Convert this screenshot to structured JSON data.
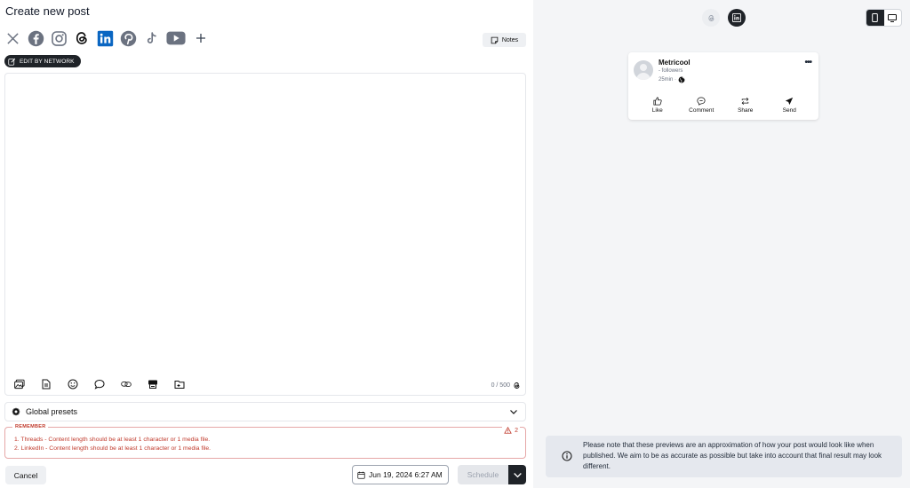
{
  "page": {
    "title": "Create new post"
  },
  "networks": [
    {
      "name": "X",
      "icon": "x-icon"
    },
    {
      "name": "Facebook",
      "icon": "facebook-icon"
    },
    {
      "name": "Instagram",
      "icon": "instagram-icon"
    },
    {
      "name": "Threads",
      "icon": "threads-icon"
    },
    {
      "name": "LinkedIn",
      "icon": "linkedin-icon"
    },
    {
      "name": "Pinterest",
      "icon": "pinterest-icon"
    },
    {
      "name": "TikTok",
      "icon": "tiktok-icon"
    },
    {
      "name": "YouTube",
      "icon": "youtube-icon"
    },
    {
      "name": "Add",
      "icon": "plus-icon"
    }
  ],
  "notes": {
    "label": "Notes"
  },
  "edit_by_network": {
    "label": "EDIT BY NETWORK"
  },
  "editor": {
    "value": "",
    "counter": "0 / 500"
  },
  "presets": {
    "label": "Global presets"
  },
  "remember": {
    "title": "REMEMBER",
    "count": "2",
    "items": [
      "1. Threads - Content length should be at least 1 character or 1 media file.",
      "2. LinkedIn - Content length should be at least 1 character or 1 media file."
    ]
  },
  "footer": {
    "cancel": "Cancel",
    "date": "Jun 19, 2024 6:27 AM",
    "schedule": "Schedule"
  },
  "preview": {
    "account_name": "Metricool",
    "followers": "- followers",
    "time": "25min ·",
    "actions": [
      "Like",
      "Comment",
      "Share",
      "Send"
    ],
    "notice": "Please note that these previews are an approximation of how your post would look like when published. We aim to be as accurate as possible but take into account that final result may look different."
  },
  "colors": {
    "linkedin": "#0a66c2",
    "dark": "#1f2328",
    "error": "#c0392b"
  }
}
